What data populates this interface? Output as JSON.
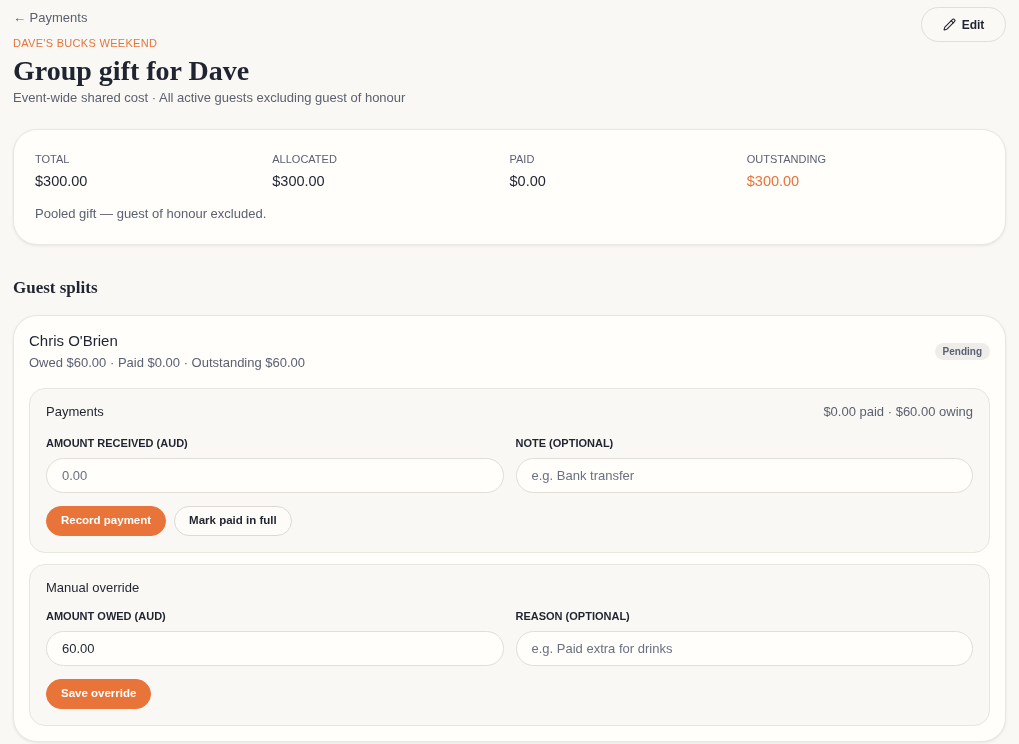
{
  "header": {
    "back_link": {
      "label": "← Payments"
    },
    "event_name": "DAVE'S BUCKS WEEKEND",
    "title": "Group gift for Dave",
    "subtitle": "Event-wide shared cost · All active guests excluding guest of honour",
    "edit_button": {
      "label": "Edit"
    }
  },
  "summary": {
    "stats": [
      {
        "label": "TOTAL",
        "value": "$300.00",
        "kind": "plain"
      },
      {
        "label": "ALLOCATED",
        "value": "$300.00",
        "kind": "plain"
      },
      {
        "label": "PAID",
        "value": "$0.00",
        "kind": "plain"
      },
      {
        "label": "OUTSTANDING",
        "value": "$300.00",
        "kind": "accent"
      }
    ],
    "note": "Pooled gift — guest of honour excluded."
  },
  "guest_splits": {
    "heading": "Guest splits",
    "guests": [
      {
        "name": "Chris O'Brien",
        "summary": "Owed $60.00 · Paid $0.00 · Outstanding $60.00",
        "status": {
          "label": "Pending"
        },
        "panels": [
          {
            "title": "Payments",
            "info": "$0.00 paid · $60.00 owing",
            "fields": [
              {
                "label": "AMOUNT RECEIVED (AUD)",
                "placeholder": "0.00"
              },
              {
                "label": "NOTE (OPTIONAL)",
                "placeholder": "e.g. Bank transfer"
              }
            ],
            "buttons": [
              {
                "label": "Record payment",
                "kind": "primary"
              },
              {
                "label": "Mark paid in full",
                "kind": "secondary"
              }
            ]
          },
          {
            "title": "Manual override",
            "fields": [
              {
                "label": "AMOUNT OWED (AUD)",
                "value": "60.00"
              },
              {
                "label": "REASON (OPTIONAL)",
                "placeholder": "e.g. Paid extra for drinks"
              }
            ],
            "buttons": [
              {
                "label": "Save override",
                "kind": "primary"
              }
            ]
          }
        ]
      }
    ]
  }
}
